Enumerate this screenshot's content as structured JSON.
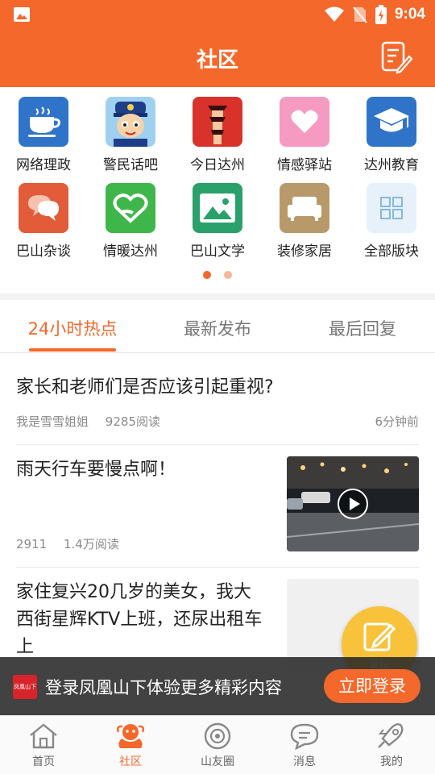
{
  "status_bar": {
    "time": "9:04"
  },
  "header": {
    "title": "社区"
  },
  "boards": [
    {
      "label": "网络理政",
      "icon": "coffee-cup-icon",
      "color": "#2f74c8"
    },
    {
      "label": "警民话吧",
      "icon": "police-avatar-icon",
      "color": "#3a86d8"
    },
    {
      "label": "今日达州",
      "icon": "tower-icon",
      "color": "#d8322b"
    },
    {
      "label": "情感驿站",
      "icon": "heart-icon",
      "color": "#f59bc2"
    },
    {
      "label": "达州教育",
      "icon": "graduation-cap-icon",
      "color": "#2f74c8"
    },
    {
      "label": "巴山杂谈",
      "icon": "chat-bubbles-icon",
      "color": "#e25c3a"
    },
    {
      "label": "情暖达州",
      "icon": "hand-heart-icon",
      "color": "#3fb64a"
    },
    {
      "label": "巴山文学",
      "icon": "landscape-icon",
      "color": "#2aa06a"
    },
    {
      "label": "装修家居",
      "icon": "sofa-icon",
      "color": "#b89a6a"
    },
    {
      "label": "全部版块",
      "icon": "grid-icon",
      "color": "#e6f1fb"
    }
  ],
  "tabs": [
    {
      "label": "24小时热点",
      "active": true
    },
    {
      "label": "最新发布",
      "active": false
    },
    {
      "label": "最后回复",
      "active": false
    }
  ],
  "posts": [
    {
      "title": "家长和老师们是否应该引起重视?",
      "author": "我是雪雪姐姐",
      "reads": "9285阅读",
      "time": "6分钟前"
    },
    {
      "title": "雨天行车要慢点啊！",
      "author": "2911",
      "reads": "1.4万阅读",
      "has_video": true
    },
    {
      "title_lines": [
        "家住复兴20几岁的美女，我大",
        "西街星辉KTV上班，还尿出租车",
        "上"
      ]
    }
  ],
  "fab": {
    "label": "发帖"
  },
  "login_banner": {
    "logo_text": "凤凰山下",
    "text": "登录凤凰山下体验更多精彩内容",
    "button": "立即登录"
  },
  "bottom_nav": [
    {
      "label": "首页",
      "icon": "home-icon",
      "active": false
    },
    {
      "label": "社区",
      "icon": "community-icon",
      "active": true
    },
    {
      "label": "山友圈",
      "icon": "circle-icon",
      "active": false
    },
    {
      "label": "消息",
      "icon": "message-icon",
      "active": false
    },
    {
      "label": "我的",
      "icon": "rocket-profile-icon",
      "active": false
    }
  ],
  "colors": {
    "brand": "#f4682b",
    "fab": "#f8c23a"
  }
}
